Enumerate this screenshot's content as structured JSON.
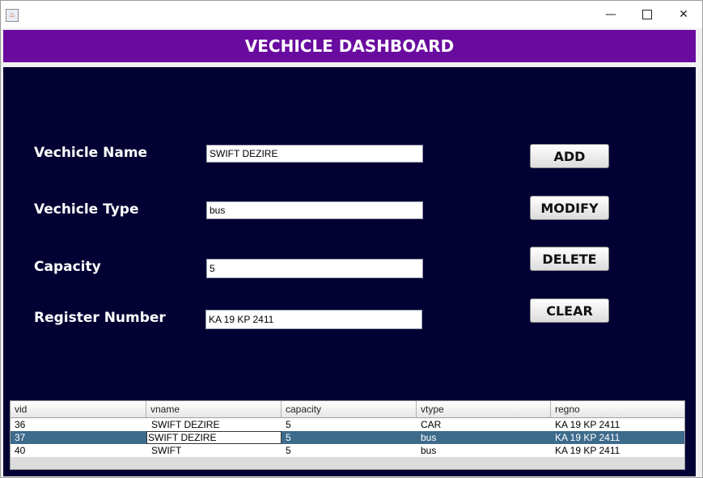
{
  "window": {
    "min_glyph": "—",
    "close_glyph": "✕",
    "icon": "java-cup-icon"
  },
  "header": {
    "title": "VECHICLE DASHBOARD",
    "bg": "#6a0ba0"
  },
  "form": {
    "name_label": "Vechicle Name",
    "name_value": "SWIFT DEZIRE",
    "type_label": "Vechicle Type",
    "type_value": "bus",
    "capacity_label": "Capacity",
    "capacity_value": "5",
    "regno_label": "Register Number",
    "regno_value": "KA 19 KP 2411"
  },
  "actions": {
    "add": "ADD",
    "modify": "MODIFY",
    "delete": "DELETE",
    "clear": "CLEAR"
  },
  "table": {
    "columns": [
      "vid",
      "vname",
      "capacity",
      "vtype",
      "regno"
    ],
    "rows": [
      [
        "36",
        "SWIFT DEZIRE",
        "5",
        "CAR",
        "KA 19 KP 2411"
      ],
      [
        "37",
        "SWIFT DEZIRE",
        "5",
        "bus",
        "KA 19 KP 2411"
      ],
      [
        "40",
        "SWIFT",
        "5",
        "bus",
        "KA 19 KP 2411"
      ]
    ],
    "selected_row": 1,
    "selection_color": "#3d6b8c"
  },
  "colors": {
    "panel_bg": "#030033"
  }
}
